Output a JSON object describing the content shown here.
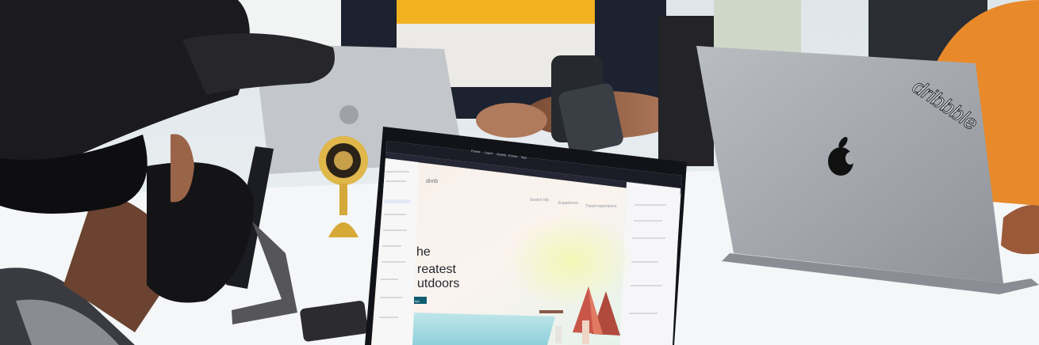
{
  "scene": {
    "sticker_text": "dribbble",
    "screen": {
      "app_tabs": [
        "Frame",
        "Layer",
        "Assets",
        "Forms",
        "Nav"
      ],
      "site_logo": "dimb",
      "nav_links": [
        "Search trip",
        "Experience",
        "Travel experience"
      ],
      "headline_lines": [
        "he",
        "reatest",
        "utdoors"
      ],
      "cta_label": "ript"
    }
  },
  "colors": {
    "background": "#e8eef2",
    "table": "#f4f6f7",
    "laptop_silver": "#a9adb3",
    "app_toolbar": "#1b1c26",
    "accent_blue": "#2f6bff",
    "cap": "#1b1b1f",
    "shirt_yellow": "#f2b11e",
    "shirt_orange": "#e8892a"
  }
}
